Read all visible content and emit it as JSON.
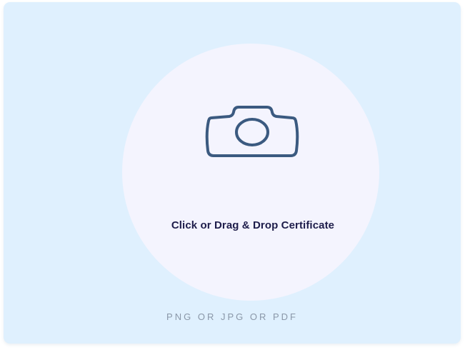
{
  "upload": {
    "prompt": "Click or Drag & Drop Certificate",
    "formats": "PNG OR JPG OR PDF",
    "icon": "camera-icon"
  },
  "colors": {
    "card_background": "#dff0fe",
    "circle_background": "#f4f4fe",
    "icon_stroke": "#3b5a80",
    "prompt_text": "#1e1d4a",
    "hint_text": "#8a97a8"
  }
}
